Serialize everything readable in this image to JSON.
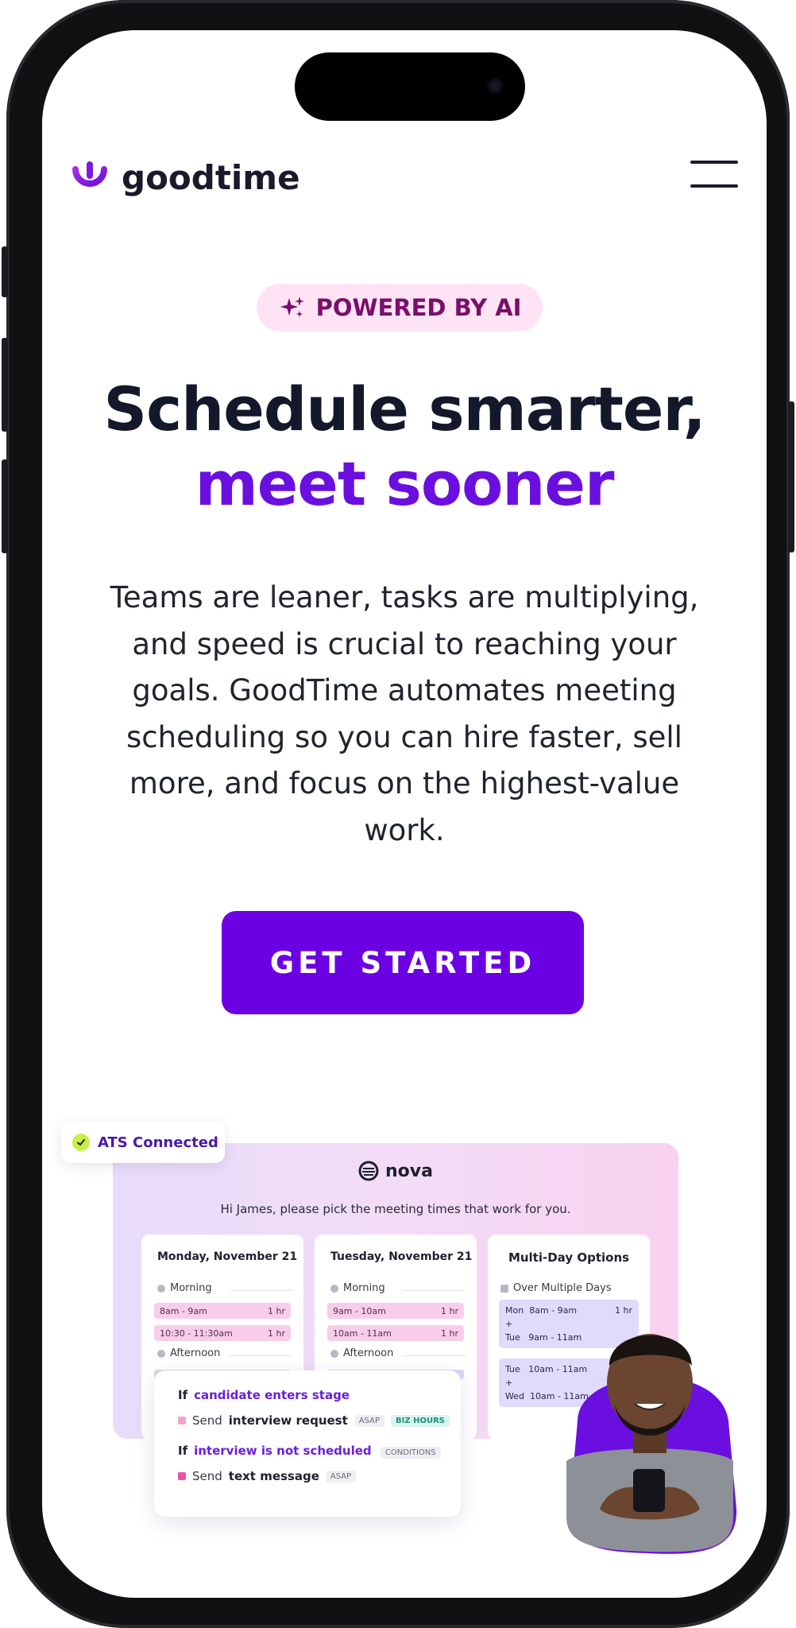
{
  "header": {
    "brand_name": "goodtime",
    "logo_icon": "goodtime-logo-icon",
    "menu_icon": "hamburger-menu-icon"
  },
  "hero": {
    "badge_label": "POWERED BY AI",
    "badge_icon": "sparkles-icon",
    "headline_line1": "Schedule smarter,",
    "headline_line2": "meet sooner",
    "lead": "Teams are leaner, tasks are multiplying, and speed is crucial to reaching your goals. GoodTime automates meeting scheduling so you can hire faster, sell more, and focus on the highest-value work.",
    "cta_label": "GET STARTED"
  },
  "illustration": {
    "ats_badge": "ATS Connected",
    "nova_label": "nova",
    "nova_prompt": "Hi James, please pick the meeting times that work for you.",
    "days": [
      {
        "title": "Monday, November 21",
        "morning_label": "Morning",
        "slots": [
          {
            "time": "8am - 9am",
            "duration": "1 hr"
          },
          {
            "time": "10:30 - 11:30am",
            "duration": "1 hr"
          }
        ],
        "afternoon_label": "Afternoon"
      },
      {
        "title": "Tuesday, November 21",
        "morning_label": "Morning",
        "slots": [
          {
            "time": "9am - 10am",
            "duration": "1 hr"
          },
          {
            "time": "10am - 11am",
            "duration": "1 hr"
          }
        ],
        "afternoon_label": "Afternoon"
      }
    ],
    "multi": {
      "title": "Multi-Day Options",
      "subtitle": "Over Multiple Days",
      "option1": {
        "day1": "Mon",
        "time1": "8am - 9am",
        "duration": "1 hr",
        "plus": "+",
        "day2": "Tue",
        "time2": "9am - 11am"
      },
      "option2": {
        "day1": "Tue",
        "time1": "10am - 11am",
        "plus": "+",
        "day2": "Wed",
        "time2": "10am - 11am"
      }
    },
    "rules": [
      {
        "if_label": "If",
        "condition": "candidate enters stage",
        "send": "Send",
        "action": "interview request",
        "tag1": "ASAP",
        "tag2": "BIZ HOURS"
      },
      {
        "if_label": "If",
        "condition": "interview is not scheduled",
        "cond_tag": "CONDITIONS",
        "send": "Send",
        "action": "text message",
        "tag1": "ASAP"
      }
    ]
  },
  "colors": {
    "accent": "#6b00e3",
    "headline_accent": "#6a0fe0",
    "badge_bg": "#fde3f3",
    "badge_text": "#7a0e6a",
    "text_dark": "#13182a"
  }
}
